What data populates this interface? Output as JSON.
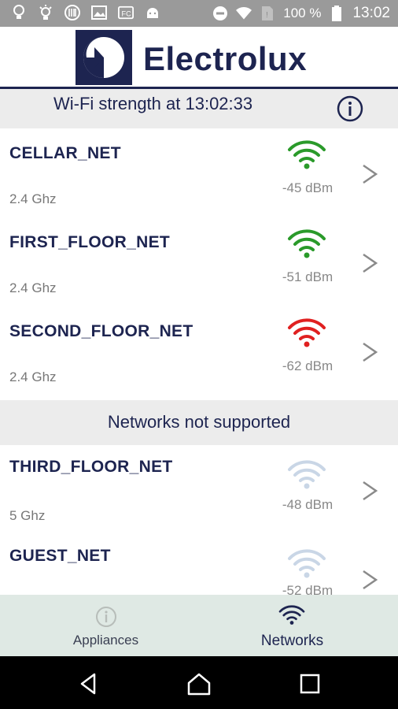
{
  "status_bar": {
    "battery_percent": "100 %",
    "time": "13:02",
    "icons": [
      "lightbulb-icon",
      "bulb-outline-icon",
      "barcode-icon",
      "image-icon",
      "fc-icon",
      "android-icon",
      "do-not-disturb-icon",
      "wifi-icon",
      "sim-icon",
      "battery-icon"
    ]
  },
  "header": {
    "brand": "Electrolux",
    "logo_icon": "electrolux-logo"
  },
  "subheader": {
    "title": "Wi-Fi strength at 13:02:33",
    "info_icon": "info-icon"
  },
  "colors": {
    "navy": "#1d2450",
    "strong": "#2a9a2a",
    "weak": "#e02020",
    "unsupported": "#c9d6e6"
  },
  "networks": [
    {
      "name": "CELLAR_NET",
      "frequency": "2.4 Ghz",
      "signal": "-45 dBm",
      "status": "good"
    },
    {
      "name": "FIRST_FLOOR_NET",
      "frequency": "2.4 Ghz",
      "signal": "-51 dBm",
      "status": "good"
    },
    {
      "name": "SECOND_FLOOR_NET",
      "frequency": "2.4 Ghz",
      "signal": "-62 dBm",
      "status": "weak"
    }
  ],
  "unsupported_section": {
    "label": "Networks not supported"
  },
  "unsupported_networks": [
    {
      "name": "THIRD_FLOOR_NET",
      "frequency": "5 Ghz",
      "signal": "-48 dBm"
    },
    {
      "name": "GUEST_NET",
      "frequency": "",
      "signal": "-52 dBm"
    }
  ],
  "bottom_nav": {
    "tabs": [
      {
        "label": "Appliances",
        "icon": "info-icon",
        "active": false
      },
      {
        "label": "Networks",
        "icon": "wifi-icon",
        "active": true
      }
    ]
  },
  "system_nav": {
    "buttons": [
      "back-icon",
      "home-icon",
      "recents-icon"
    ]
  }
}
